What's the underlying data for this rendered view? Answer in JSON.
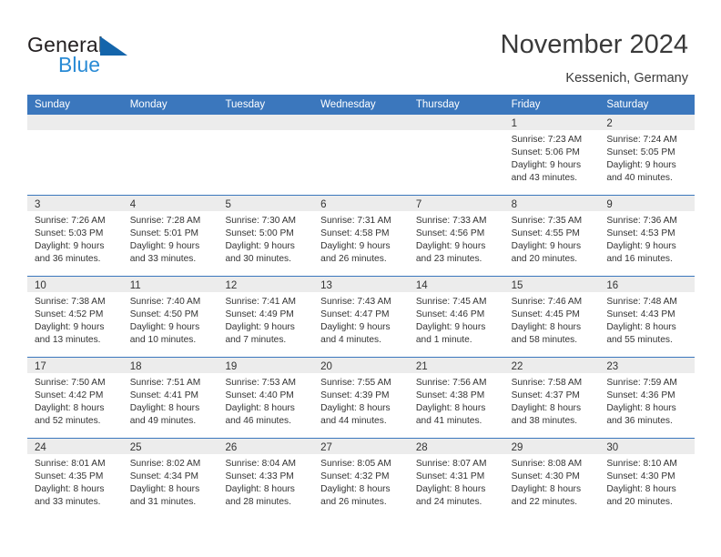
{
  "brand": {
    "name_part1": "General",
    "name_part2": "Blue",
    "accent_color": "#1465ab",
    "secondary_color": "#2a8bd5"
  },
  "header": {
    "title": "November 2024",
    "location": "Kessenich, Germany"
  },
  "calendar": {
    "header_color": "#3b77bd",
    "daynum_band_color": "#ececec",
    "weekdays": [
      "Sunday",
      "Monday",
      "Tuesday",
      "Wednesday",
      "Thursday",
      "Friday",
      "Saturday"
    ],
    "weeks": [
      [
        {
          "day": "",
          "empty": true,
          "lines": []
        },
        {
          "day": "",
          "empty": true,
          "lines": []
        },
        {
          "day": "",
          "empty": true,
          "lines": []
        },
        {
          "day": "",
          "empty": true,
          "lines": []
        },
        {
          "day": "",
          "empty": true,
          "lines": []
        },
        {
          "day": "1",
          "empty": false,
          "lines": [
            "Sunrise: 7:23 AM",
            "Sunset: 5:06 PM",
            "Daylight: 9 hours",
            "and 43 minutes."
          ]
        },
        {
          "day": "2",
          "empty": false,
          "lines": [
            "Sunrise: 7:24 AM",
            "Sunset: 5:05 PM",
            "Daylight: 9 hours",
            "and 40 minutes."
          ]
        }
      ],
      [
        {
          "day": "3",
          "empty": false,
          "lines": [
            "Sunrise: 7:26 AM",
            "Sunset: 5:03 PM",
            "Daylight: 9 hours",
            "and 36 minutes."
          ]
        },
        {
          "day": "4",
          "empty": false,
          "lines": [
            "Sunrise: 7:28 AM",
            "Sunset: 5:01 PM",
            "Daylight: 9 hours",
            "and 33 minutes."
          ]
        },
        {
          "day": "5",
          "empty": false,
          "lines": [
            "Sunrise: 7:30 AM",
            "Sunset: 5:00 PM",
            "Daylight: 9 hours",
            "and 30 minutes."
          ]
        },
        {
          "day": "6",
          "empty": false,
          "lines": [
            "Sunrise: 7:31 AM",
            "Sunset: 4:58 PM",
            "Daylight: 9 hours",
            "and 26 minutes."
          ]
        },
        {
          "day": "7",
          "empty": false,
          "lines": [
            "Sunrise: 7:33 AM",
            "Sunset: 4:56 PM",
            "Daylight: 9 hours",
            "and 23 minutes."
          ]
        },
        {
          "day": "8",
          "empty": false,
          "lines": [
            "Sunrise: 7:35 AM",
            "Sunset: 4:55 PM",
            "Daylight: 9 hours",
            "and 20 minutes."
          ]
        },
        {
          "day": "9",
          "empty": false,
          "lines": [
            "Sunrise: 7:36 AM",
            "Sunset: 4:53 PM",
            "Daylight: 9 hours",
            "and 16 minutes."
          ]
        }
      ],
      [
        {
          "day": "10",
          "empty": false,
          "lines": [
            "Sunrise: 7:38 AM",
            "Sunset: 4:52 PM",
            "Daylight: 9 hours",
            "and 13 minutes."
          ]
        },
        {
          "day": "11",
          "empty": false,
          "lines": [
            "Sunrise: 7:40 AM",
            "Sunset: 4:50 PM",
            "Daylight: 9 hours",
            "and 10 minutes."
          ]
        },
        {
          "day": "12",
          "empty": false,
          "lines": [
            "Sunrise: 7:41 AM",
            "Sunset: 4:49 PM",
            "Daylight: 9 hours",
            "and 7 minutes."
          ]
        },
        {
          "day": "13",
          "empty": false,
          "lines": [
            "Sunrise: 7:43 AM",
            "Sunset: 4:47 PM",
            "Daylight: 9 hours",
            "and 4 minutes."
          ]
        },
        {
          "day": "14",
          "empty": false,
          "lines": [
            "Sunrise: 7:45 AM",
            "Sunset: 4:46 PM",
            "Daylight: 9 hours",
            "and 1 minute."
          ]
        },
        {
          "day": "15",
          "empty": false,
          "lines": [
            "Sunrise: 7:46 AM",
            "Sunset: 4:45 PM",
            "Daylight: 8 hours",
            "and 58 minutes."
          ]
        },
        {
          "day": "16",
          "empty": false,
          "lines": [
            "Sunrise: 7:48 AM",
            "Sunset: 4:43 PM",
            "Daylight: 8 hours",
            "and 55 minutes."
          ]
        }
      ],
      [
        {
          "day": "17",
          "empty": false,
          "lines": [
            "Sunrise: 7:50 AM",
            "Sunset: 4:42 PM",
            "Daylight: 8 hours",
            "and 52 minutes."
          ]
        },
        {
          "day": "18",
          "empty": false,
          "lines": [
            "Sunrise: 7:51 AM",
            "Sunset: 4:41 PM",
            "Daylight: 8 hours",
            "and 49 minutes."
          ]
        },
        {
          "day": "19",
          "empty": false,
          "lines": [
            "Sunrise: 7:53 AM",
            "Sunset: 4:40 PM",
            "Daylight: 8 hours",
            "and 46 minutes."
          ]
        },
        {
          "day": "20",
          "empty": false,
          "lines": [
            "Sunrise: 7:55 AM",
            "Sunset: 4:39 PM",
            "Daylight: 8 hours",
            "and 44 minutes."
          ]
        },
        {
          "day": "21",
          "empty": false,
          "lines": [
            "Sunrise: 7:56 AM",
            "Sunset: 4:38 PM",
            "Daylight: 8 hours",
            "and 41 minutes."
          ]
        },
        {
          "day": "22",
          "empty": false,
          "lines": [
            "Sunrise: 7:58 AM",
            "Sunset: 4:37 PM",
            "Daylight: 8 hours",
            "and 38 minutes."
          ]
        },
        {
          "day": "23",
          "empty": false,
          "lines": [
            "Sunrise: 7:59 AM",
            "Sunset: 4:36 PM",
            "Daylight: 8 hours",
            "and 36 minutes."
          ]
        }
      ],
      [
        {
          "day": "24",
          "empty": false,
          "lines": [
            "Sunrise: 8:01 AM",
            "Sunset: 4:35 PM",
            "Daylight: 8 hours",
            "and 33 minutes."
          ]
        },
        {
          "day": "25",
          "empty": false,
          "lines": [
            "Sunrise: 8:02 AM",
            "Sunset: 4:34 PM",
            "Daylight: 8 hours",
            "and 31 minutes."
          ]
        },
        {
          "day": "26",
          "empty": false,
          "lines": [
            "Sunrise: 8:04 AM",
            "Sunset: 4:33 PM",
            "Daylight: 8 hours",
            "and 28 minutes."
          ]
        },
        {
          "day": "27",
          "empty": false,
          "lines": [
            "Sunrise: 8:05 AM",
            "Sunset: 4:32 PM",
            "Daylight: 8 hours",
            "and 26 minutes."
          ]
        },
        {
          "day": "28",
          "empty": false,
          "lines": [
            "Sunrise: 8:07 AM",
            "Sunset: 4:31 PM",
            "Daylight: 8 hours",
            "and 24 minutes."
          ]
        },
        {
          "day": "29",
          "empty": false,
          "lines": [
            "Sunrise: 8:08 AM",
            "Sunset: 4:30 PM",
            "Daylight: 8 hours",
            "and 22 minutes."
          ]
        },
        {
          "day": "30",
          "empty": false,
          "lines": [
            "Sunrise: 8:10 AM",
            "Sunset: 4:30 PM",
            "Daylight: 8 hours",
            "and 20 minutes."
          ]
        }
      ]
    ]
  }
}
